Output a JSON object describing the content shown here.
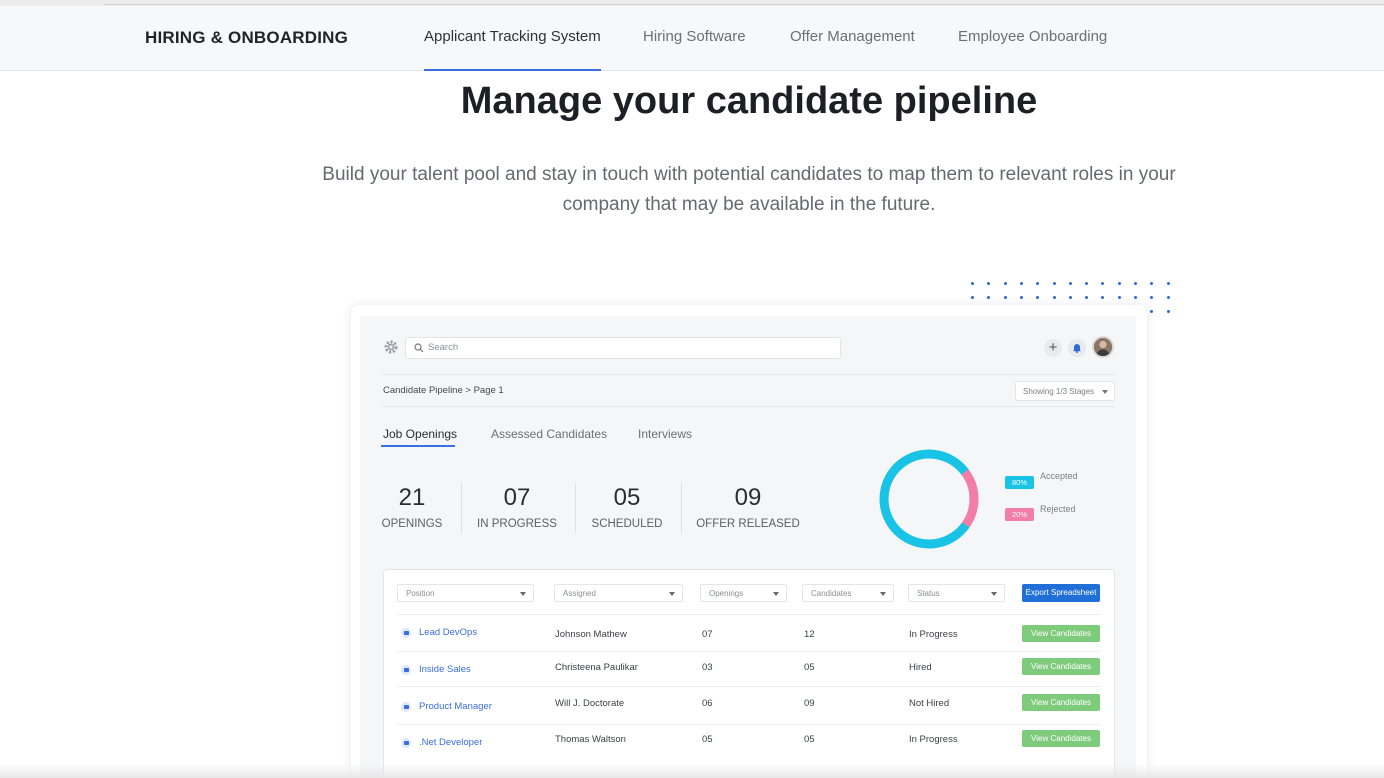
{
  "nav": {
    "brand": "HIRING & ONBOARDING",
    "items": [
      "Applicant Tracking System",
      "Hiring Software",
      "Offer Management",
      "Employee Onboarding"
    ],
    "active_index": 0
  },
  "hero": {
    "title": "Manage your candidate pipeline",
    "subtitle": "Build your talent pool and stay in touch with potential candidates to map them to relevant roles in your company that may be available in the future."
  },
  "app": {
    "search_placeholder": "Search",
    "plus_label": "+",
    "breadcrumb": "Candidate Pipeline > Page 1",
    "stages_select": "Showing 1/3 Stages",
    "tabs": [
      "Job Openings",
      "Assessed Candidates",
      "Interviews"
    ],
    "stats": [
      {
        "value": "21",
        "label": "OPENINGS"
      },
      {
        "value": "07",
        "label": "IN PROGRESS"
      },
      {
        "value": "05",
        "label": "SCHEDULED"
      },
      {
        "value": "09",
        "label": "OFFER RELEASED"
      }
    ],
    "donut": {
      "accepted_pct": 80,
      "rejected_pct": 20,
      "accepted_badge": "80%",
      "rejected_badge": "20%",
      "accepted_label": "Accepted",
      "rejected_label": "Rejected",
      "accepted_color": "#19c3e6",
      "rejected_color": "#f27ea8"
    },
    "filters": [
      "Position",
      "Assigned",
      "Openings",
      "Candidates",
      "Status"
    ],
    "export_label": "Export Spreadsheet",
    "view_label": "View Candidates",
    "rows": [
      {
        "position": "Lead DevOps",
        "assigned": "Johnson Mathew",
        "openings": "07",
        "candidates": "12",
        "status": "In Progress"
      },
      {
        "position": "Inside Sales",
        "assigned": "Christeena Paulikar",
        "openings": "03",
        "candidates": "05",
        "status": "Hired"
      },
      {
        "position": "Product Manager",
        "assigned": "Will J. Doctorate",
        "openings": "06",
        "candidates": "09",
        "status": "Not Hired"
      },
      {
        "position": ".Net Developer",
        "assigned": "Thomas Waltson",
        "openings": "05",
        "candidates": "05",
        "status": "In Progress"
      }
    ]
  },
  "colors": {
    "accent": "#3a6ee0",
    "export_button": "#1f6fd6",
    "view_button": "#7fcb7c"
  }
}
